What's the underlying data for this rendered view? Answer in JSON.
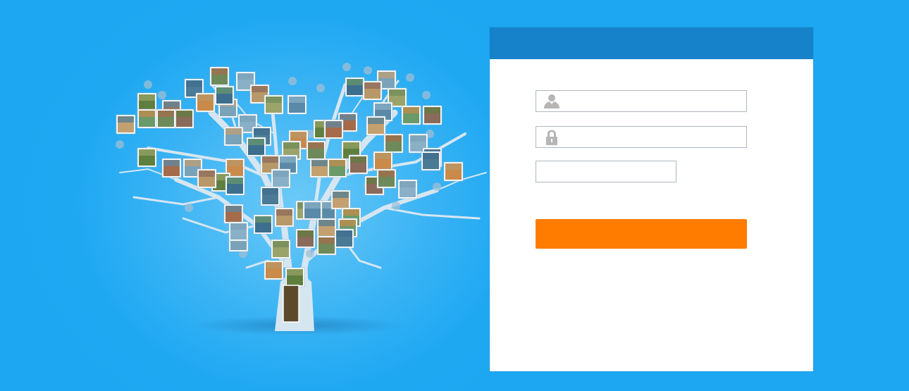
{
  "login": {
    "header_title": "",
    "username": {
      "value": "",
      "placeholder": ""
    },
    "password": {
      "value": "",
      "placeholder": ""
    },
    "captcha": {
      "value": "",
      "placeholder": ""
    },
    "submit_label": ""
  },
  "icons": {
    "username": "user-icon",
    "password": "lock-icon"
  },
  "colors": {
    "background": "#1da6f1",
    "header": "#1582c9",
    "button": "#ff7c00",
    "field_border": "#aeb6bd",
    "icon": "#b5b5b5"
  }
}
